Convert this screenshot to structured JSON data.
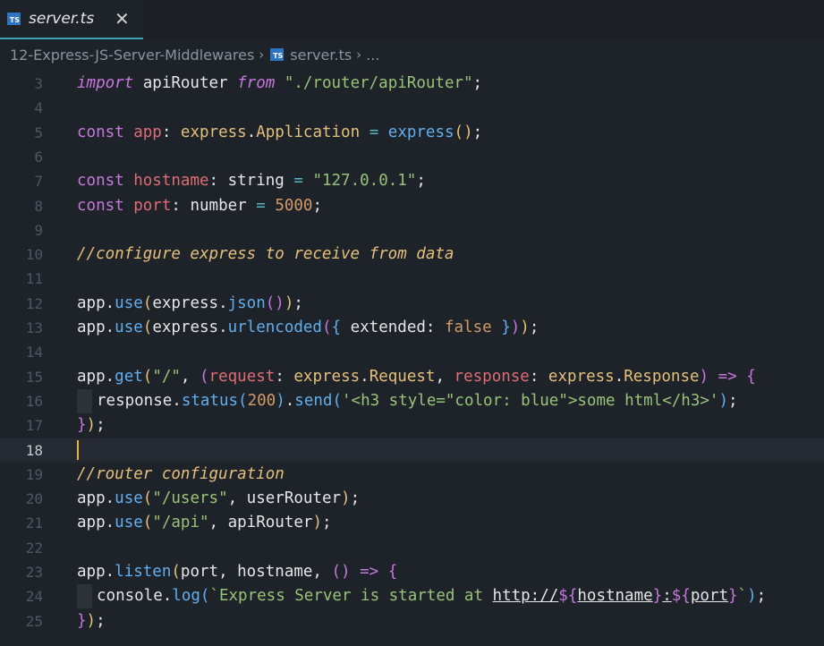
{
  "tab": {
    "filename": "server.ts",
    "icon": "TS",
    "close_glyph": "✕"
  },
  "breadcrumb": {
    "folder": "12-Express-JS-Server-Middlewares",
    "file": "server.ts",
    "ellipsis": "...",
    "separator": "›"
  },
  "colors": {
    "background": "#1e2229",
    "keyword": "#c678dd",
    "variable": "#e06c75",
    "type": "#e5c07b",
    "function": "#61afef",
    "string": "#98c379",
    "number": "#d19a66",
    "comment": "#e5c07b",
    "cursor": "#e8b14a"
  },
  "editor": {
    "current_line": 18,
    "line_numbers": [
      "3",
      "4",
      "5",
      "6",
      "7",
      "8",
      "9",
      "10",
      "11",
      "12",
      "13",
      "14",
      "15",
      "16",
      "17",
      "18",
      "19",
      "20",
      "21",
      "22",
      "23",
      "24",
      "25"
    ],
    "lines": [
      [
        [
          "kwi",
          "import"
        ],
        [
          "pn",
          " apiRouter "
        ],
        [
          "kwi",
          "from"
        ],
        [
          "pn",
          " "
        ],
        [
          "str",
          "\"./router/apiRouter\""
        ],
        [
          "pn",
          ";"
        ]
      ],
      [],
      [
        [
          "kw",
          "const"
        ],
        [
          "pn",
          " "
        ],
        [
          "var",
          "app"
        ],
        [
          "pn",
          ": "
        ],
        [
          "ty",
          "express"
        ],
        [
          "pn",
          "."
        ],
        [
          "ty",
          "Application"
        ],
        [
          "pn",
          " "
        ],
        [
          "op",
          "="
        ],
        [
          "pn",
          " "
        ],
        [
          "fn",
          "express"
        ],
        [
          "br1",
          "()"
        ],
        [
          "pn",
          ";"
        ]
      ],
      [],
      [
        [
          "kw",
          "const"
        ],
        [
          "pn",
          " "
        ],
        [
          "var",
          "hostname"
        ],
        [
          "pn",
          ": string "
        ],
        [
          "op",
          "="
        ],
        [
          "pn",
          " "
        ],
        [
          "str",
          "\"127.0.0.1\""
        ],
        [
          "pn",
          ";"
        ]
      ],
      [
        [
          "kw",
          "const"
        ],
        [
          "pn",
          " "
        ],
        [
          "var",
          "port"
        ],
        [
          "pn",
          ": number "
        ],
        [
          "op",
          "="
        ],
        [
          "pn",
          " "
        ],
        [
          "num",
          "5000"
        ],
        [
          "pn",
          ";"
        ]
      ],
      [],
      [
        [
          "cm",
          "//configure express to receive from data"
        ]
      ],
      [],
      [
        [
          "pn",
          "app."
        ],
        [
          "fn",
          "use"
        ],
        [
          "br1",
          "("
        ],
        [
          "pn",
          "express."
        ],
        [
          "fn",
          "json"
        ],
        [
          "br2",
          "()"
        ],
        [
          "br1",
          ")"
        ],
        [
          "pn",
          ";"
        ]
      ],
      [
        [
          "pn",
          "app."
        ],
        [
          "fn",
          "use"
        ],
        [
          "br1",
          "("
        ],
        [
          "pn",
          "express."
        ],
        [
          "fn",
          "urlencoded"
        ],
        [
          "br2",
          "("
        ],
        [
          "br3",
          "{"
        ],
        [
          "pn",
          " extended: "
        ],
        [
          "num",
          "false"
        ],
        [
          "pn",
          " "
        ],
        [
          "br3",
          "}"
        ],
        [
          "br2",
          ")"
        ],
        [
          "br1",
          ")"
        ],
        [
          "pn",
          ";"
        ]
      ],
      [],
      [
        [
          "pn",
          "app."
        ],
        [
          "fn",
          "get"
        ],
        [
          "br1",
          "("
        ],
        [
          "str",
          "\"/\""
        ],
        [
          "pn",
          ", "
        ],
        [
          "br2",
          "("
        ],
        [
          "var",
          "request"
        ],
        [
          "pn",
          ": "
        ],
        [
          "ty",
          "express"
        ],
        [
          "pn",
          "."
        ],
        [
          "ty",
          "Request"
        ],
        [
          "pn",
          ", "
        ],
        [
          "var",
          "response"
        ],
        [
          "pn",
          ": "
        ],
        [
          "ty",
          "express"
        ],
        [
          "pn",
          "."
        ],
        [
          "ty",
          "Response"
        ],
        [
          "br2",
          ")"
        ],
        [
          "pn",
          " "
        ],
        [
          "kw",
          "=>"
        ],
        [
          "pn",
          " "
        ],
        [
          "br2",
          "{"
        ]
      ],
      [
        [
          "guide",
          ""
        ],
        [
          "pn",
          "response."
        ],
        [
          "fn",
          "status"
        ],
        [
          "br3",
          "("
        ],
        [
          "num",
          "200"
        ],
        [
          "br3",
          ")"
        ],
        [
          "pn",
          "."
        ],
        [
          "fn",
          "send"
        ],
        [
          "br3",
          "("
        ],
        [
          "str",
          "'<h3 style=\"color: blue\">some html</h3>'"
        ],
        [
          "br3",
          ")"
        ],
        [
          "pn",
          ";"
        ]
      ],
      [
        [
          "br2",
          "}"
        ],
        [
          "br1",
          ")"
        ],
        [
          "pn",
          ";"
        ]
      ],
      [
        [
          "cursor",
          ""
        ]
      ],
      [
        [
          "cm",
          "//router configuration"
        ]
      ],
      [
        [
          "pn",
          "app."
        ],
        [
          "fn",
          "use"
        ],
        [
          "br1",
          "("
        ],
        [
          "str",
          "\"/users\""
        ],
        [
          "pn",
          ", userRouter"
        ],
        [
          "br1",
          ")"
        ],
        [
          "pn",
          ";"
        ]
      ],
      [
        [
          "pn",
          "app."
        ],
        [
          "fn",
          "use"
        ],
        [
          "br1",
          "("
        ],
        [
          "str",
          "\"/api\""
        ],
        [
          "pn",
          ", apiRouter"
        ],
        [
          "br1",
          ")"
        ],
        [
          "pn",
          ";"
        ]
      ],
      [],
      [
        [
          "pn",
          "app."
        ],
        [
          "fn",
          "listen"
        ],
        [
          "br1",
          "("
        ],
        [
          "pn",
          "port, hostname, "
        ],
        [
          "br2",
          "()"
        ],
        [
          "pn",
          " "
        ],
        [
          "kw",
          "=>"
        ],
        [
          "pn",
          " "
        ],
        [
          "br2",
          "{"
        ]
      ],
      [
        [
          "guide",
          ""
        ],
        [
          "pn",
          "console."
        ],
        [
          "fn",
          "log"
        ],
        [
          "br3",
          "("
        ],
        [
          "str",
          "`Express Server is started at "
        ],
        [
          "url",
          "http://"
        ],
        [
          "kw",
          "${"
        ],
        [
          "url",
          "hostname"
        ],
        [
          "kw",
          "}"
        ],
        [
          "url",
          ":"
        ],
        [
          "kw",
          "${"
        ],
        [
          "url",
          "port"
        ],
        [
          "kw",
          "}"
        ],
        [
          "str",
          "`"
        ],
        [
          "br3",
          ")"
        ],
        [
          "pn",
          ";"
        ]
      ],
      [
        [
          "br2",
          "}"
        ],
        [
          "br1",
          ")"
        ],
        [
          "pn",
          ";"
        ]
      ]
    ]
  }
}
